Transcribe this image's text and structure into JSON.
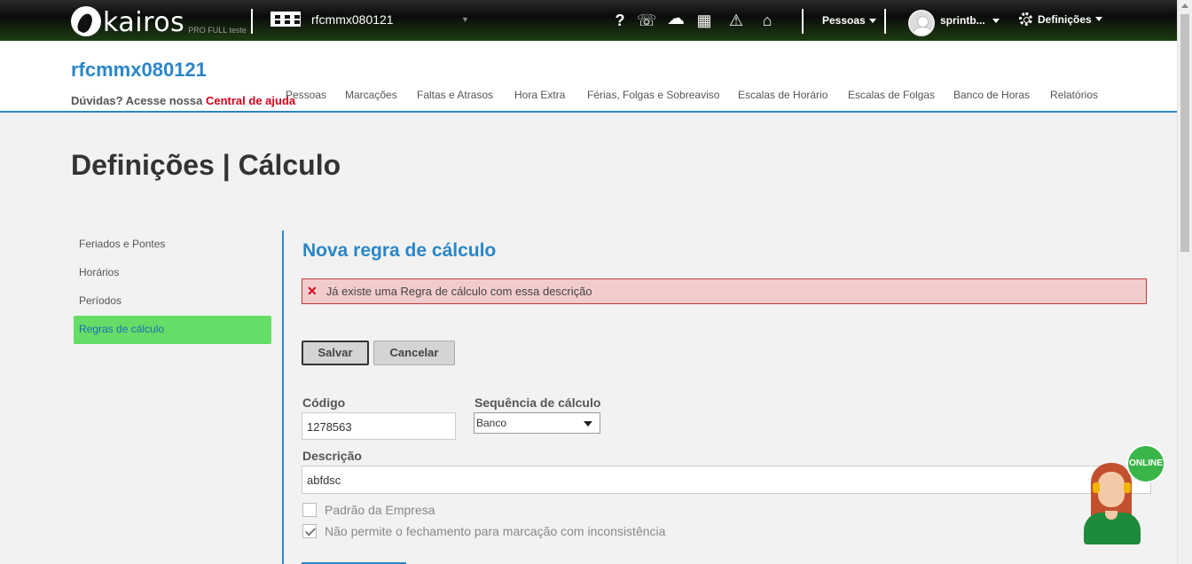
{
  "topbar": {
    "logo_text": "kairos",
    "logo_sub": "PRO FULL teste",
    "company_name": "rfcmmx080121",
    "company_caret": "▼",
    "icons": [
      "help-icon",
      "support-icon",
      "cloud-download-icon",
      "calculator-icon",
      "warning-icon",
      "inbox-icon"
    ],
    "help_glyph": "?",
    "support_glyph": "☏",
    "cloud_glyph": "☁",
    "calculator_glyph": "▦",
    "warning_glyph": "⚠",
    "inbox_glyph": "⌂",
    "people_menu": "Pessoas",
    "user_menu": "sprintb...",
    "settings_menu": "Definições"
  },
  "header": {
    "title": "rfcmmx080121",
    "help_text": "Dúvidas? Acesse nossa ",
    "help_link": "Central de ajuda",
    "nav": [
      "Pessoas",
      "Marcações",
      "Faltas e Atrasos",
      "Hora Extra",
      "Férias, Folgas e Sobreaviso",
      "Escalas de Horário",
      "Escalas de Folgas",
      "Banco de Horas",
      "Relatórios"
    ]
  },
  "page": {
    "title": "Definições | Cálculo"
  },
  "sidebar": {
    "items": [
      {
        "label": "Feriados e Pontes",
        "active": false
      },
      {
        "label": "Horários",
        "active": false
      },
      {
        "label": "Períodos",
        "active": false
      },
      {
        "label": "Regras de cálculo",
        "active": true
      }
    ]
  },
  "form": {
    "section_title": "Nova regra de cálculo",
    "error_icon": "✕",
    "error_message": "Já existe uma Regra de cálculo com essa descrição",
    "save_label": "Salvar",
    "cancel_label": "Cancelar",
    "code_label": "Código",
    "code_value": "1278563",
    "sequence_label": "Sequência de cálculo",
    "sequence_value": "Banco",
    "description_label": "Descrição",
    "description_value": "abfdsc",
    "company_default_label": "Padrão da Empresa",
    "company_default_checked": false,
    "no_close_label": "Não permite o fechamento para marcação com inconsistência",
    "no_close_checked": true
  },
  "chat": {
    "status": "ONLINE"
  },
  "colors": {
    "accent": "#2a86c8",
    "active_menu": "#66dd66",
    "error_bg": "#f2cccc",
    "help_link": "#d0021b",
    "online": "#3ab54a"
  }
}
